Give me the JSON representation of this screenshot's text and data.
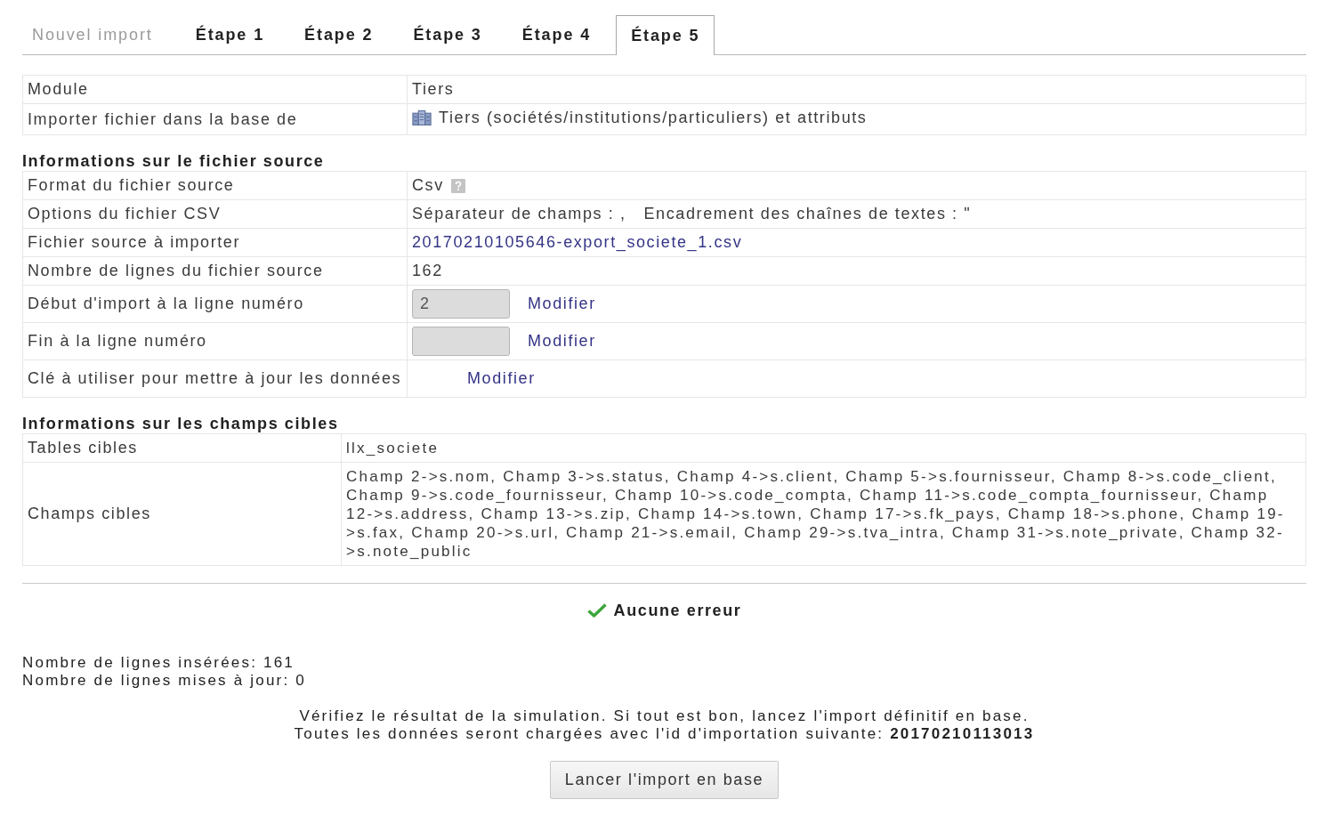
{
  "tabs": [
    {
      "label": "Nouvel import",
      "selected": false,
      "disabled": true
    },
    {
      "label": "Étape 1",
      "selected": false,
      "disabled": false
    },
    {
      "label": "Étape 2",
      "selected": false,
      "disabled": false
    },
    {
      "label": "Étape 3",
      "selected": false,
      "disabled": false
    },
    {
      "label": "Étape 4",
      "selected": false,
      "disabled": false
    },
    {
      "label": "Étape 5",
      "selected": true,
      "disabled": false
    }
  ],
  "summary": {
    "rows": [
      {
        "kind": "text",
        "label": "Module",
        "value": "Tiers"
      },
      {
        "kind": "icon_text",
        "label": "Importer fichier dans la base de",
        "value": "Tiers (sociétés/institutions/particuliers) et attributs"
      }
    ]
  },
  "source": {
    "title": "Informations sur le fichier source",
    "rows": [
      {
        "kind": "help_text",
        "label": "Format du fichier source",
        "value": "Csv"
      },
      {
        "kind": "options",
        "label": "Options du fichier CSV",
        "options": [
          "Séparateur de champs : ,",
          "Encadrement des chaînes de textes : \""
        ]
      },
      {
        "kind": "link",
        "label": "Fichier source à importer",
        "value": "20170210105646-export_societe_1.csv"
      },
      {
        "kind": "text",
        "label": "Nombre de lignes du fichier source",
        "value": "162"
      },
      {
        "kind": "field",
        "label": "Début d'import à la ligne numéro",
        "value": "2",
        "disabled": true,
        "action": "Modifier"
      },
      {
        "kind": "field",
        "label": "Fin à la ligne numéro",
        "disabled": true,
        "action": "Modifier"
      },
      {
        "kind": "action",
        "label": "Clé à utiliser pour mettre à jour les données",
        "action": "Modifier"
      }
    ]
  },
  "target": {
    "title": "Informations sur les champs cibles",
    "rows": [
      {
        "label": "Tables cibles",
        "value": "llx_societe"
      },
      {
        "label": "Champs cibles",
        "value": "Champ 2->s.nom, Champ 3->s.status, Champ 4->s.client, Champ 5->s.fournisseur, Champ 8->s.code_client, Champ 9->s.code_fournisseur, Champ 10->s.code_compta, Champ 11->s.code_compta_fournisseur, Champ 12->s.address, Champ 13->s.zip, Champ 14->s.town, Champ 17->s.fk_pays, Champ 18->s.phone, Champ 19->s.fax, Champ 20->s.url, Champ 21->s.email, Champ 29->s.tva_intra, Champ 31->s.note_private, Champ 32->s.note_public"
      }
    ]
  },
  "result": {
    "status": "Aucune erreur",
    "stats": [
      "Nombre de lignes insérées: 161",
      "Nombre de lignes mises à jour: 0"
    ],
    "notice": [
      "Vérifiez le résultat de la simulation. Si tout est bon, lancez l'import définitif en base.",
      "Toutes les données seront chargées avec l'id d'importation suivante: **20170210113013**"
    ],
    "button": "Lancer l'import en base"
  }
}
